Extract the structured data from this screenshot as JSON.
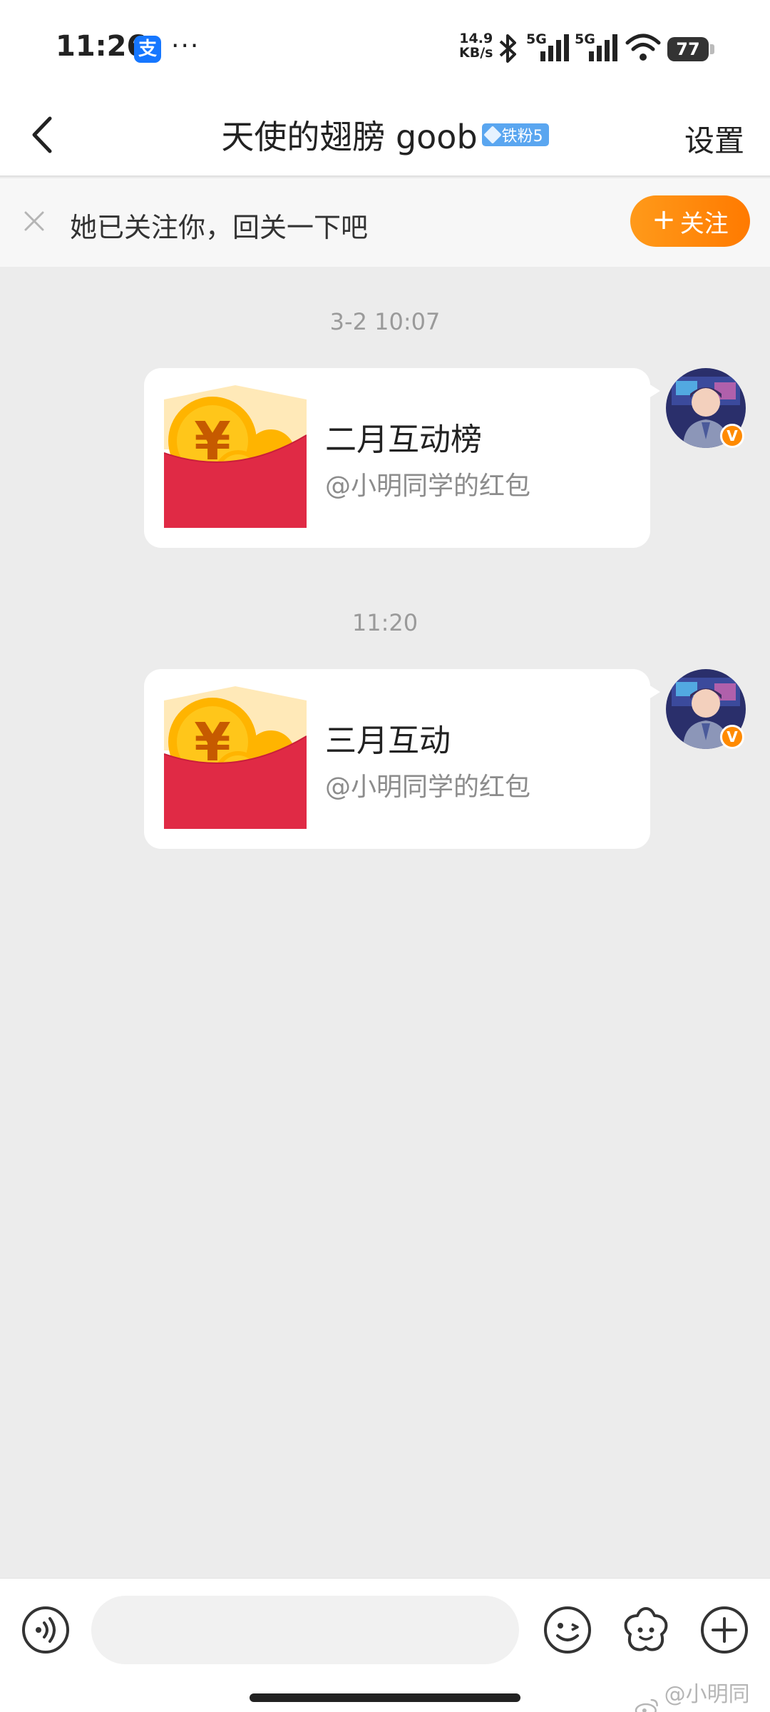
{
  "status_bar": {
    "time": "11:26",
    "alipay_glyph": "支",
    "more": "···",
    "net_speed_value": "14.9",
    "net_speed_unit": "KB/s",
    "signal_1": "5G",
    "signal_2": "5G",
    "battery": "77"
  },
  "header": {
    "title": "天使的翅膀 goob",
    "fan_badge": "铁粉5",
    "settings_label": "设置"
  },
  "follow_banner": {
    "text": "她已关注你，回关一下吧",
    "follow_label": "关注"
  },
  "messages": [
    {
      "timestamp": "3-2 10:07",
      "title": "二月互动榜",
      "subtitle": "@小明同学的红包"
    },
    {
      "timestamp": "11:20",
      "title": "三月互动",
      "subtitle": "@小明同学的红包"
    }
  ],
  "input_bar": {
    "placeholder": ""
  },
  "watermark": "@小明同学",
  "colors": {
    "accent_orange": "#ff8a00",
    "badge_blue": "#5aa6f0",
    "red_packet": "#e02a45",
    "coin": "#ffb400"
  }
}
